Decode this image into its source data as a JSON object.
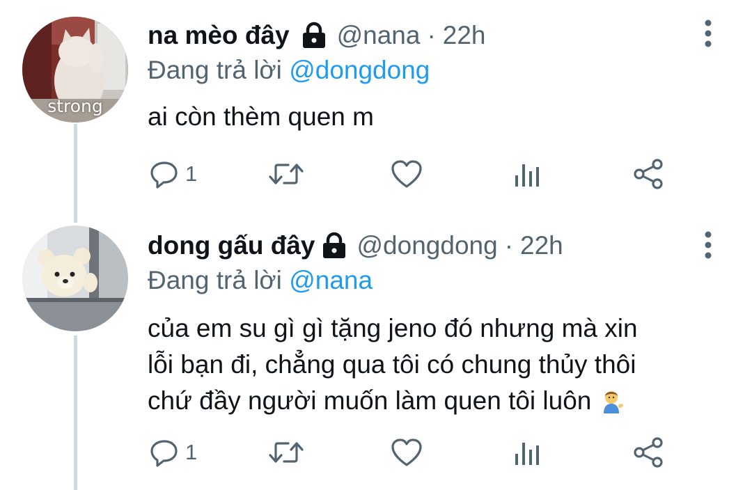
{
  "tweets": [
    {
      "name": "na mèo đây",
      "handle": "@nana",
      "separator": "·",
      "time": "22h",
      "reply_prefix": "Đang trả lời ",
      "reply_to": "@dongdong",
      "text_lines": [
        "ai còn thèm quen m"
      ],
      "avatar_caption": "strong",
      "reply_count": "1",
      "icons": {
        "lock": "lock-icon",
        "more": "more-vertical-icon",
        "reply": "reply-icon",
        "retweet": "retweet-icon",
        "like": "heart-icon",
        "analytics": "analytics-icon",
        "share": "share-icon"
      }
    },
    {
      "name": "dong gấu đây",
      "handle": "@dongdong",
      "separator": "·",
      "time": "22h",
      "reply_prefix": "Đang trả lời ",
      "reply_to": "@nana",
      "text_lines": [
        "của em su gì gì tặng jeno đó nhưng mà xin",
        "lỗi bạn đi, chẳng qua tôi có chung thủy thôi",
        "chứ đầy người muốn làm quen tôi luôn"
      ],
      "emoji": "person-tipping-hand-emoji",
      "reply_count": "1",
      "icons": {
        "lock": "lock-icon",
        "more": "more-vertical-icon",
        "reply": "reply-icon",
        "retweet": "retweet-icon",
        "like": "heart-icon",
        "analytics": "analytics-icon",
        "share": "share-icon"
      }
    }
  ],
  "colors": {
    "text_primary": "#0f1419",
    "text_secondary": "#536471",
    "mention": "#1d9bf0",
    "thread_line": "#cfd9de",
    "background": "#ffffff"
  }
}
